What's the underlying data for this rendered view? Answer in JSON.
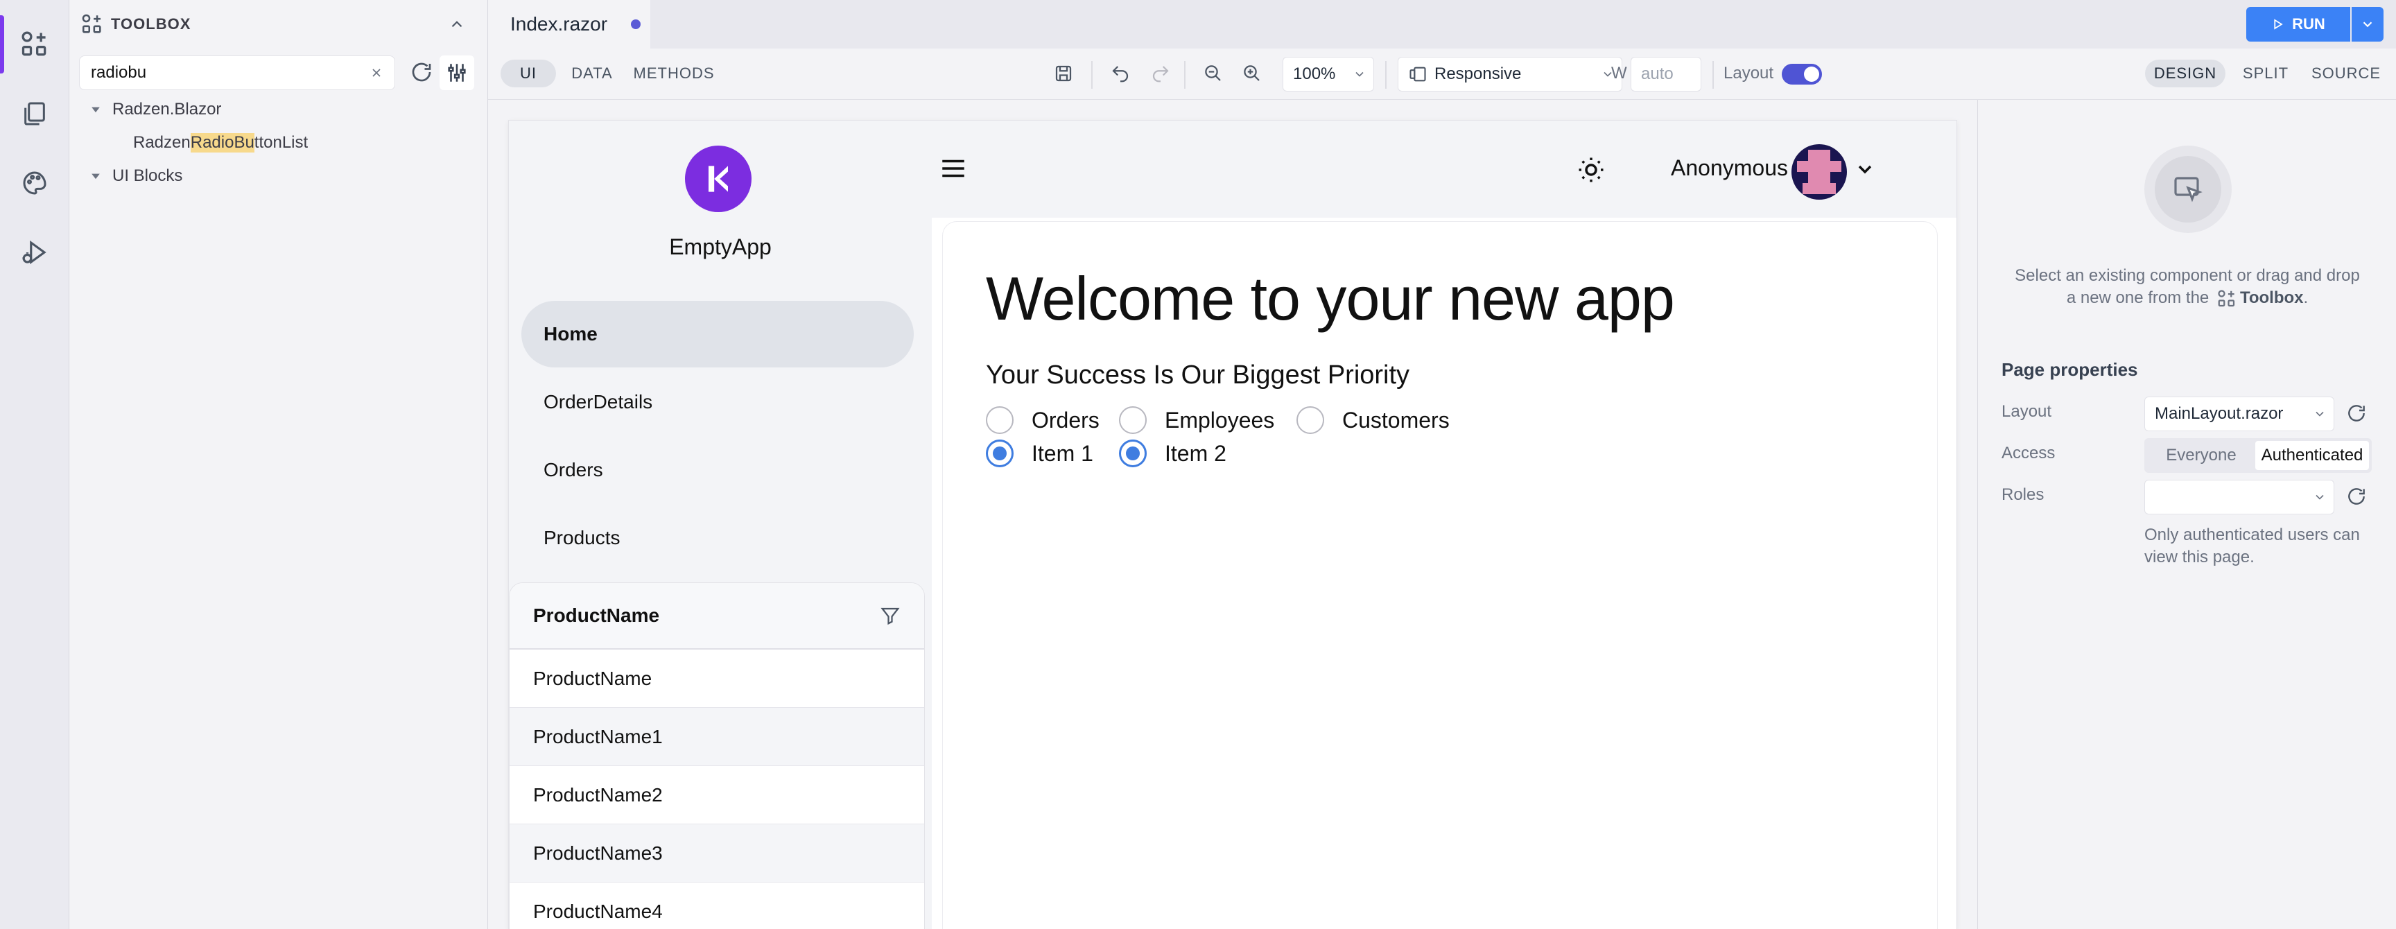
{
  "colors": {
    "accent": "#7c3aed",
    "run": "#3b82f6",
    "radio": "#3f7de0",
    "highlight": "#f7d98c"
  },
  "activity_bar": {
    "items": [
      "toolbox-icon",
      "pages-icon",
      "themes-icon",
      "debug-icon"
    ]
  },
  "toolbox": {
    "title": "TOOLBOX",
    "search_value": "radiobu",
    "tree": {
      "group1": "Radzen.Blazor",
      "item_pre": "Radzen",
      "item_hl": "RadioBu",
      "item_post": "ttonList",
      "group2": "UI Blocks"
    }
  },
  "tabs": {
    "file": "Index.razor",
    "unsaved": true
  },
  "run": {
    "label": "RUN"
  },
  "toolbar": {
    "modes": [
      "UI",
      "DATA",
      "METHODS"
    ],
    "zoom": "100%",
    "device": "Responsive",
    "width_label": "W",
    "width_placeholder": "auto",
    "layout_label": "Layout",
    "layout_on": true,
    "views": [
      "DESIGN",
      "SPLIT",
      "SOURCE"
    ]
  },
  "app": {
    "brand": "EmptyApp",
    "nav": [
      "Home",
      "OrderDetails",
      "Orders",
      "Products"
    ],
    "user": "Anonymous",
    "grid": {
      "header": "ProductName",
      "rows": [
        "ProductName",
        "ProductName1",
        "ProductName2",
        "ProductName3",
        "ProductName4"
      ]
    },
    "title": "Welcome to your new app",
    "subtitle": "Your Success Is Our Biggest Priority",
    "radios1": [
      "Orders",
      "Employees",
      "Customers"
    ],
    "radios2": [
      "Item 1",
      "Item 2"
    ]
  },
  "properties": {
    "hint_line1": "Select an existing component or drag and drop",
    "hint_line2_pre": "a new one from the",
    "hint_toolbox": "Toolbox",
    "hint_dot": ".",
    "section": "Page properties",
    "layout_label": "Layout",
    "layout_value": "MainLayout.razor",
    "access_label": "Access",
    "access_options": [
      "Everyone",
      "Authenticated"
    ],
    "roles_label": "Roles",
    "roles_value": "",
    "note_line1": "Only authenticated users can",
    "note_line2": "view this page."
  }
}
